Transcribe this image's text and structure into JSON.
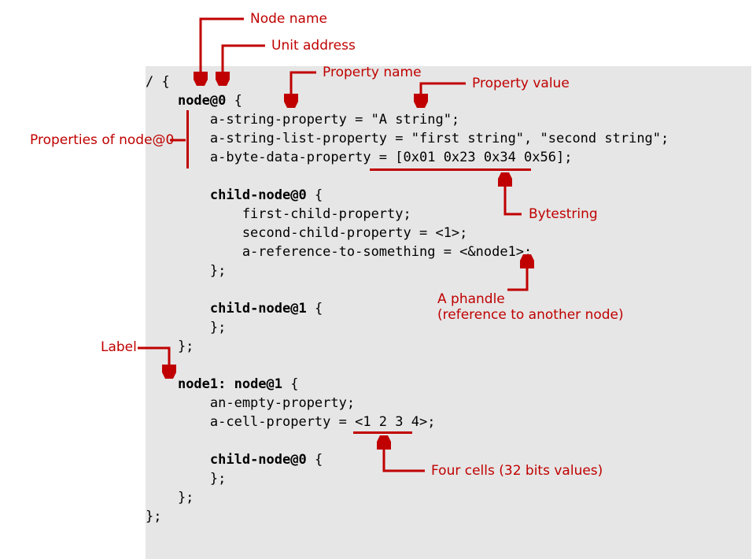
{
  "annotations": {
    "node_name": "Node name",
    "unit_address": "Unit address",
    "property_name": "Property name",
    "property_value": "Property value",
    "properties_of": "Properties of node@0",
    "bytestring": "Bytestring",
    "phandle_line1": "A phandle",
    "phandle_line2": "(reference to another node)",
    "label": "Label",
    "four_cells": "Four cells (32 bits values)"
  },
  "code": {
    "l1": "/ {",
    "l2_a": "    ",
    "l2_b": "node@0",
    "l2_c": " {",
    "l3": "        a-string-property = \"A string\";",
    "l4": "        a-string-list-property = \"first string\", \"second string\";",
    "l5": "        a-byte-data-property = [0x01 0x23 0x34 0x56];",
    "l6": "",
    "l7_a": "        ",
    "l7_b": "child-node@0",
    "l7_c": " {",
    "l8": "            first-child-property;",
    "l9": "            second-child-property = <1>;",
    "l10": "            a-reference-to-something = <&node1>;",
    "l11": "        };",
    "l12": "",
    "l13_a": "        ",
    "l13_b": "child-node@1",
    "l13_c": " {",
    "l14": "        };",
    "l15": "    };",
    "l16": "",
    "l17_a": "    ",
    "l17_b": "node1: node@1",
    "l17_c": " {",
    "l18": "        an-empty-property;",
    "l19": "        a-cell-property = <1 2 3 4>;",
    "l20": "",
    "l21_a": "        ",
    "l21_b": "child-node@0",
    "l21_c": " {",
    "l22": "        };",
    "l23": "    };",
    "l24": "};"
  }
}
